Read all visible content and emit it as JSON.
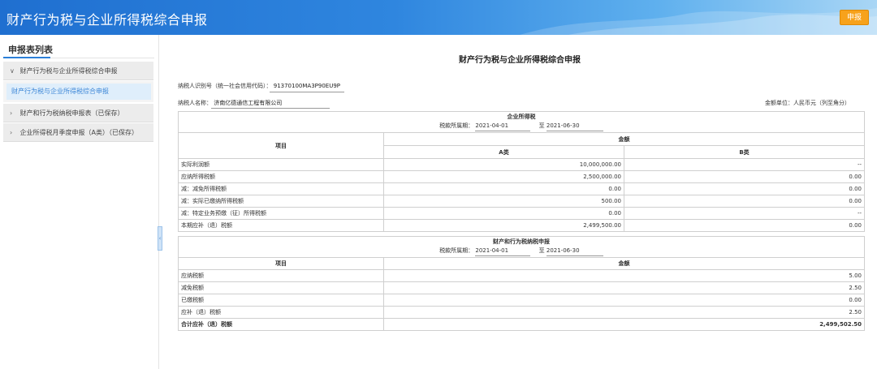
{
  "header": {
    "title": "财产行为税与企业所得税综合申报",
    "submit_label": "申报"
  },
  "sidebar": {
    "list_title": "申报表列表",
    "items": [
      {
        "label": "财产行为税与企业所得税综合申报",
        "expanded": true
      },
      {
        "label": "财产行为税与企业所得税综合申报",
        "selected": true
      },
      {
        "label": "财产和行为税纳税申报表（已保存）"
      },
      {
        "label": "企业所得税月季度申报（A类）（已保存）"
      }
    ]
  },
  "doc": {
    "title": "财产行为税与企业所得税综合申报",
    "taxpayer_id_label": "纳税人识别号（统一社会信用代码）：",
    "taxpayer_id": "91370100MA3P90EU9P",
    "taxpayer_name_label": "纳税人名称：",
    "taxpayer_name": "济南亿德通信工程有限公司",
    "unit_note": "金额单位：人民币元（列至角分）"
  },
  "cit": {
    "section_title": "企业所得税",
    "period_label": "税款所属期：",
    "period_from": "2021-04-01",
    "period_to_label": "至",
    "period_to": "2021-06-30",
    "col_item": "项目",
    "col_amount": "金额",
    "col_a": "A类",
    "col_b": "B类",
    "rows": [
      {
        "item": "实际利润额",
        "a": "10,000,000.00",
        "b": "--"
      },
      {
        "item": "应纳所得税额",
        "a": "2,500,000.00",
        "b": "0.00"
      },
      {
        "item": "减：减免所得税额",
        "a": "0.00",
        "b": "0.00"
      },
      {
        "item": "减：实际已缴纳所得税额",
        "a": "500.00",
        "b": "0.00"
      },
      {
        "item": "减：特定业务预缴（征）所得税额",
        "a": "0.00",
        "b": "--"
      },
      {
        "item": "本期应补（退）税额",
        "a": "2,499,500.00",
        "b": "0.00"
      }
    ]
  },
  "ppt": {
    "section_title": "财产和行为税纳税申报",
    "period_label": "税款所属期：",
    "period_from": "2021-04-01",
    "period_to_label": "至",
    "period_to": "2021-06-30",
    "col_item": "项目",
    "col_amount": "金额",
    "rows": [
      {
        "item": "应纳税额",
        "amount": "5.00"
      },
      {
        "item": "减免税额",
        "amount": "2.50"
      },
      {
        "item": "已缴税额",
        "amount": "0.00"
      },
      {
        "item": "应补（退）税额",
        "amount": "2.50"
      }
    ],
    "total_label": "合计应补（退）税额",
    "total_amount": "2,499,502.50"
  }
}
